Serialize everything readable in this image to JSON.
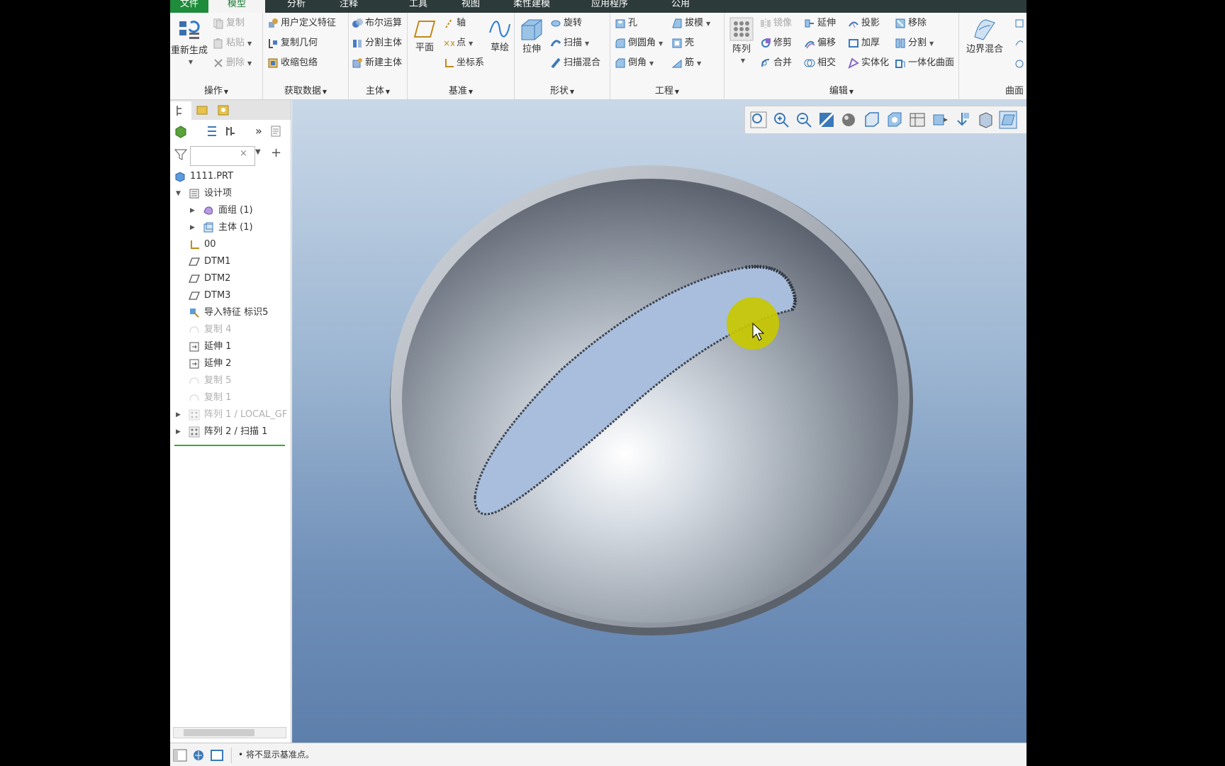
{
  "tabs": [
    "文件",
    "模型",
    "分析",
    "注释",
    "工具",
    "视图",
    "柔性建模",
    "应用程序",
    "公用"
  ],
  "ribbon": {
    "operations": {
      "label": "操作",
      "regen": "重新生成",
      "copy": "复制",
      "paste": "粘贴",
      "delete": "删除"
    },
    "get_data": {
      "label": "获取数据",
      "udf": "用户定义特征",
      "copy_geom": "复制几何",
      "shrinkwrap": "收缩包络"
    },
    "body": {
      "label": "主体",
      "boolean": "布尔运算",
      "split_body": "分割主体",
      "new_body": "新建主体"
    },
    "datum": {
      "label": "基准",
      "plane": "平面",
      "axis": "轴",
      "point": "点",
      "csys": "坐标系",
      "sketch": "草绘"
    },
    "shapes": {
      "label": "形状",
      "extrude": "拉伸",
      "revolve": "旋转",
      "sweep": "扫描",
      "swept_blend": "扫描混合"
    },
    "engineering": {
      "label": "工程",
      "hole": "孔",
      "round": "倒圆角",
      "chamfer": "倒角",
      "draft": "拔模",
      "shell": "壳",
      "rib": "筋"
    },
    "editing": {
      "label": "编辑",
      "pattern": "阵列",
      "mirror": "镜像",
      "extend": "延伸",
      "project": "投影",
      "trim": "修剪",
      "offset": "偏移",
      "thicken": "加厚",
      "merge": "合并",
      "intersect": "相交",
      "solidify": "实体化",
      "remove": "移除",
      "split": "分割",
      "unify": "一体化曲面"
    },
    "surfaces": {
      "label": "曲面",
      "boundary_blend": "边界混合"
    }
  },
  "tree": {
    "filter_value": "",
    "items": [
      {
        "label": "1111.PRT",
        "level": 0,
        "expander": "",
        "icon": "part-icon",
        "dim": false
      },
      {
        "label": "设计项",
        "level": 1,
        "expander": "▼",
        "icon": "design-items-icon",
        "dim": false
      },
      {
        "label": "面组 (1)",
        "level": 2,
        "expander": "▶",
        "icon": "quilt-icon",
        "dim": false
      },
      {
        "label": "主体 (1)",
        "level": 2,
        "expander": "▶",
        "icon": "body-icon",
        "dim": false
      },
      {
        "label": "00",
        "level": 1,
        "expander": "",
        "icon": "csys-icon",
        "dim": false
      },
      {
        "label": "DTM1",
        "level": 1,
        "expander": "",
        "icon": "datum-plane-icon",
        "dim": false
      },
      {
        "label": "DTM2",
        "level": 1,
        "expander": "",
        "icon": "datum-plane-icon",
        "dim": false
      },
      {
        "label": "DTM3",
        "level": 1,
        "expander": "",
        "icon": "datum-plane-icon",
        "dim": false
      },
      {
        "label": "导入特征 标识5",
        "level": 1,
        "expander": "",
        "icon": "import-feature-icon",
        "dim": false
      },
      {
        "label": "复制 4",
        "level": 1,
        "expander": "",
        "icon": "copy-feature-icon",
        "dim": true
      },
      {
        "label": "延伸 1",
        "level": 1,
        "expander": "",
        "icon": "extend-feature-icon",
        "dim": false
      },
      {
        "label": "延伸 2",
        "level": 1,
        "expander": "",
        "icon": "extend-feature-icon",
        "dim": false
      },
      {
        "label": "复制 5",
        "level": 1,
        "expander": "",
        "icon": "copy-feature-icon",
        "dim": true
      },
      {
        "label": "复制 1",
        "level": 1,
        "expander": "",
        "icon": "copy-feature-icon",
        "dim": true
      },
      {
        "label": "阵列 1 / LOCAL_GF",
        "level": 1,
        "expander": "▶",
        "icon": "pattern-icon",
        "dim": true
      },
      {
        "label": "阵列 2 / 扫描 1",
        "level": 1,
        "expander": "▶",
        "icon": "pattern-icon",
        "dim": false
      }
    ]
  },
  "status": {
    "message": "• 将不显示基准点。"
  },
  "colors": {
    "accent": "#1b7a34",
    "file_tab": "#1e8c3a",
    "tabbar": "#2d3a3a",
    "cursor_highlight": "#c8c800"
  }
}
